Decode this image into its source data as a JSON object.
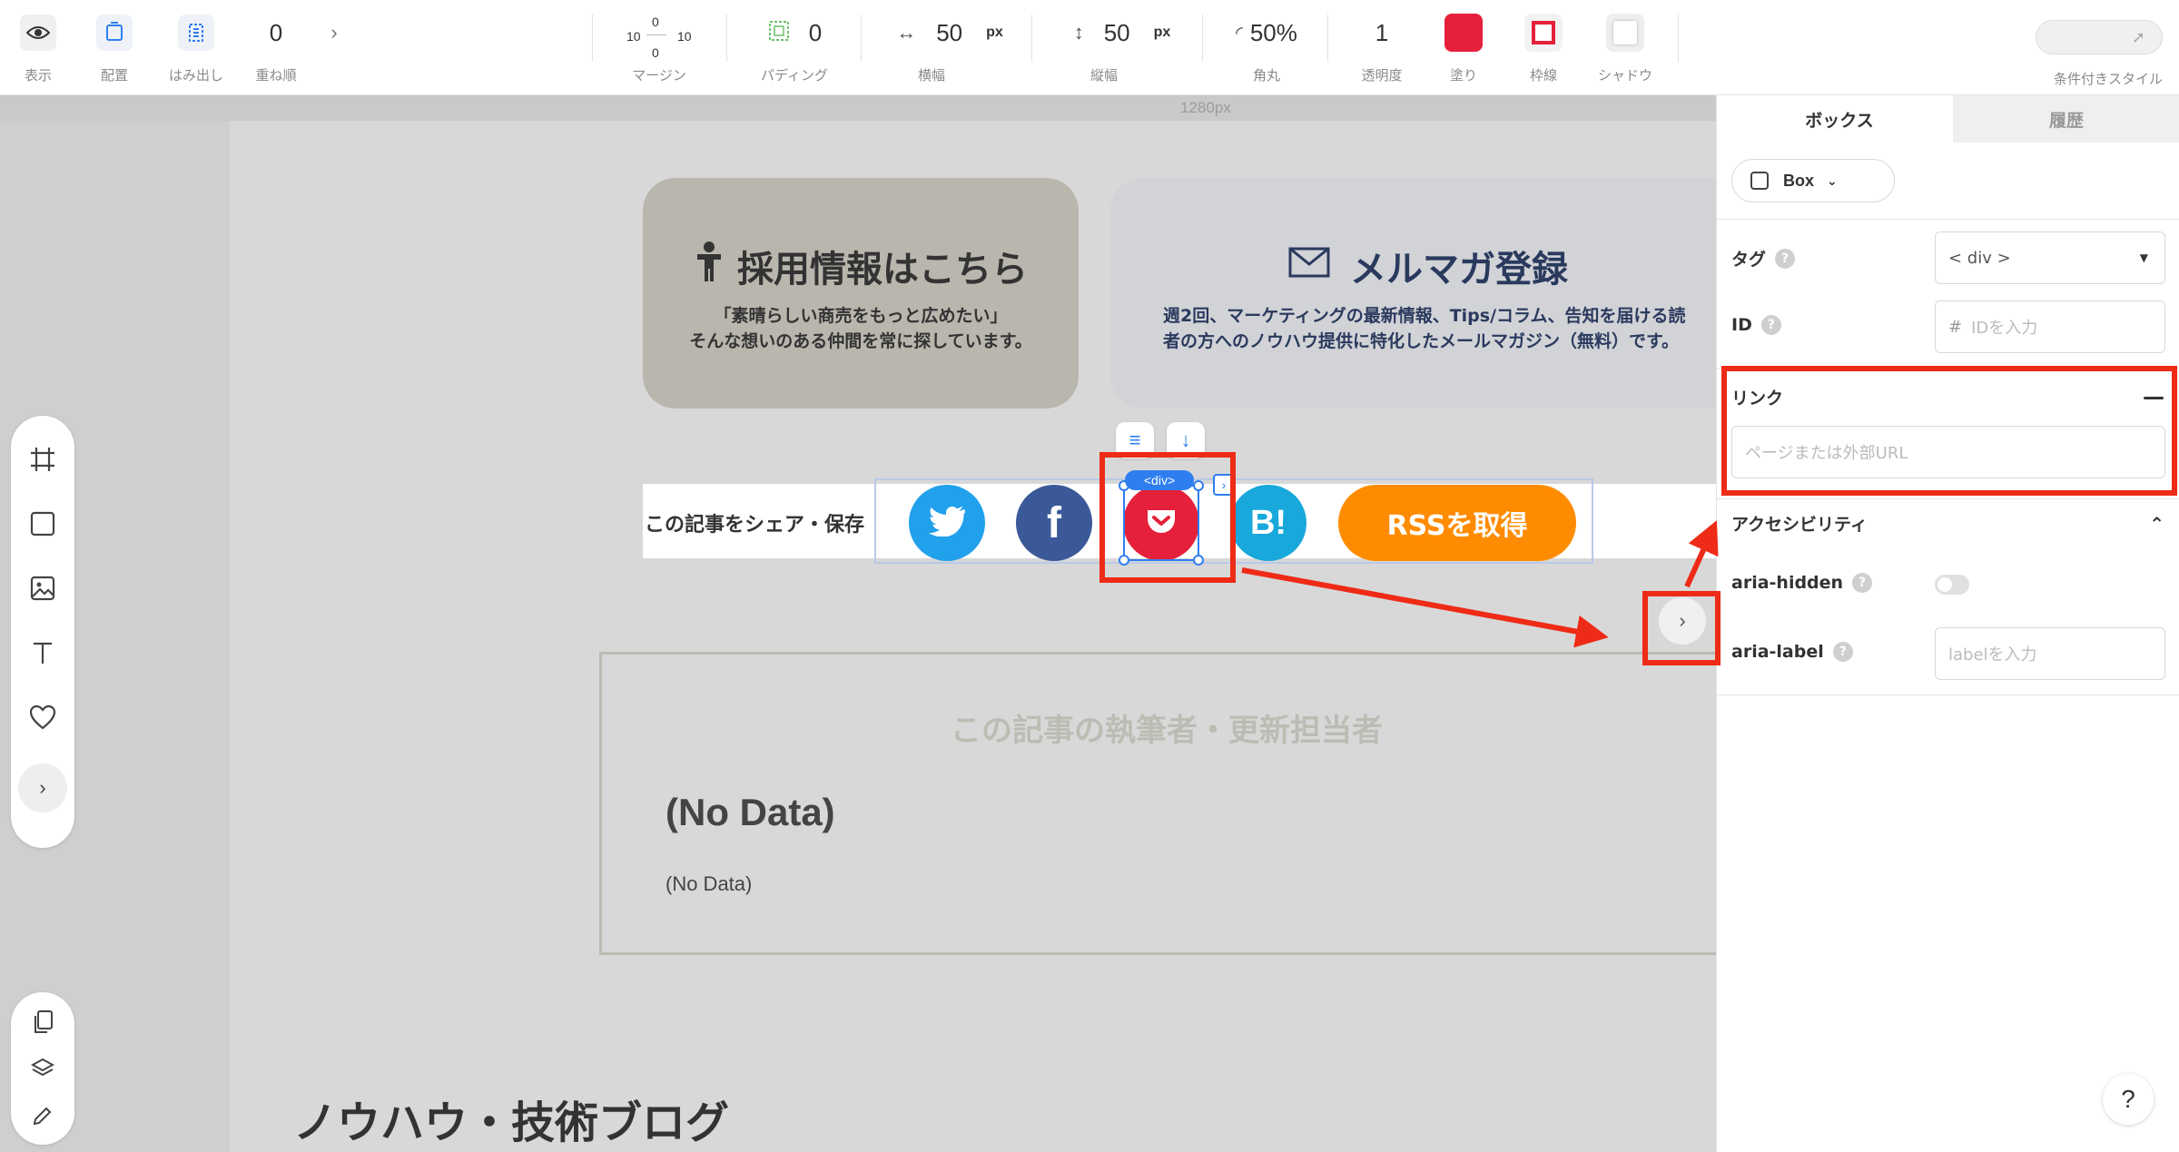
{
  "toolbar": {
    "view_label": "表示",
    "place_label": "配置",
    "overflow_label": "はみ出し",
    "zorder_value": "0",
    "zorder_label": "重ね順",
    "margin": {
      "top": "0",
      "left": "10",
      "right": "10",
      "bottom": "0",
      "label": "マージン"
    },
    "padding": {
      "value": "0",
      "label": "パディング"
    },
    "width": {
      "value": "50",
      "unit": "px",
      "label": "横幅"
    },
    "height": {
      "value": "50",
      "unit": "px",
      "label": "縦幅"
    },
    "radius": {
      "value": "50%",
      "label": "角丸"
    },
    "opacity": {
      "value": "1",
      "label": "透明度"
    },
    "fill": {
      "label": "塗り",
      "color": "#e5203a"
    },
    "border": {
      "label": "枠線",
      "color": "#e5203a"
    },
    "shadow": {
      "label": "シャドウ"
    },
    "conditional_label": "条件付きスタイル"
  },
  "canvas": {
    "ruler_label": "1280px",
    "recruit_card": {
      "title": "採用情報はこちら",
      "desc": "「素晴らしい商売をもっと広めたい」\nそんな想いのある仲間を常に探しています。"
    },
    "mail_card": {
      "title": "メルマガ登録",
      "desc": "週2回、マーケティングの最新情報、Tips/コラム、告知を届ける読\n者の方へのノウハウ提供に特化したメールマガジン（無料）です。"
    },
    "share_label": "この記事をシェア・保存",
    "share_buttons": {
      "facebook": "f",
      "hatena": "B!",
      "rss": "RSSを取得"
    },
    "selected_tag": "<div>",
    "author": {
      "heading": "この記事の執筆者・更新担当者",
      "name": "(No Data)",
      "bio": "(No Data)"
    },
    "blog_title": "ノウハウ・技術ブログ"
  },
  "inspector": {
    "tabs": [
      "ボックス",
      "履歴"
    ],
    "component": "Box",
    "tag_label": "タグ",
    "tag_value": "< div >",
    "id_label": "ID",
    "id_prefix": "#",
    "id_placeholder": "IDを入力",
    "link_label": "リンク",
    "link_placeholder": "ページまたは外部URL",
    "a11y_label": "アクセシビリティ",
    "aria_hidden_label": "aria-hidden",
    "aria_label_label": "aria-label",
    "aria_label_placeholder": "labelを入力",
    "help_fab": "?"
  },
  "colors": {
    "accent": "#2f7ef0",
    "annotation": "#ee2b16",
    "twitter": "#21a0ec",
    "facebook": "#3b5998",
    "pocket": "#e5203a",
    "hatena": "#18a8dc",
    "rss": "#ff8c00"
  }
}
